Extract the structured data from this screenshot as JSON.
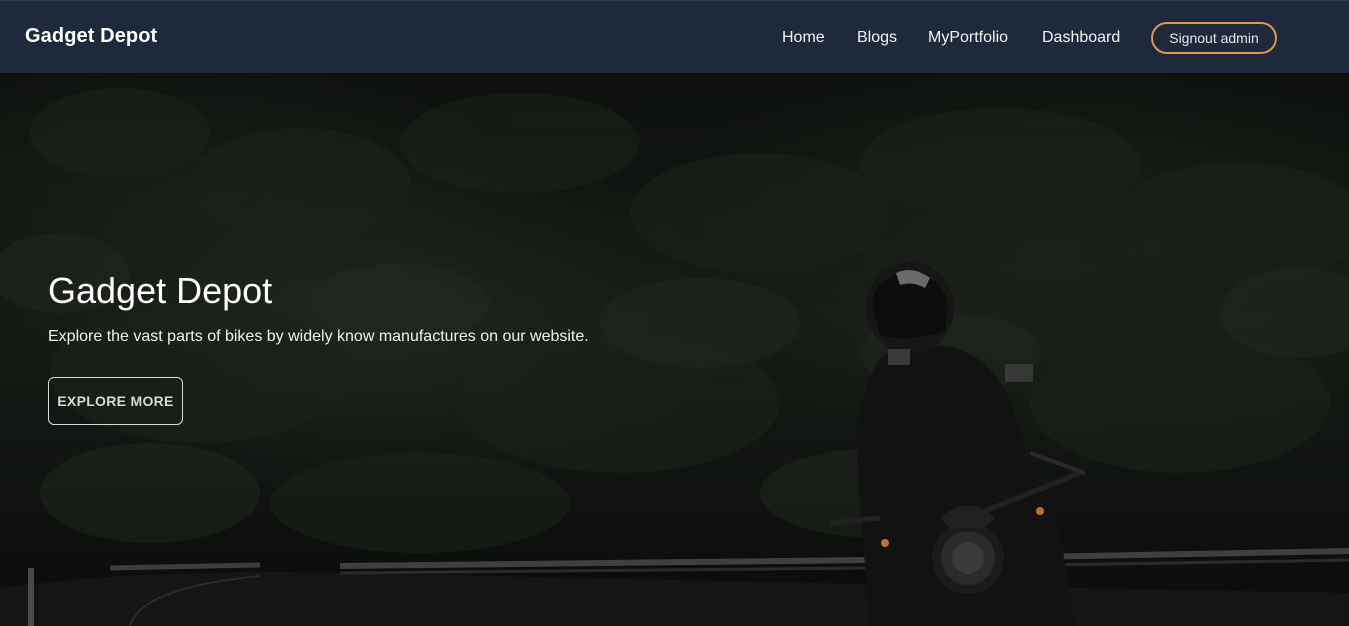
{
  "navbar": {
    "brand": "Gadget Depot",
    "links": [
      "Home",
      "Blogs",
      "MyPortfolio",
      "Dashboard"
    ],
    "signout_label": "Signout admin",
    "background_color": "#1e293b",
    "signout_border_color": "#e7944b"
  },
  "hero": {
    "title": "Gadget Depot",
    "subtitle": "Explore the vast parts of bikes by widely know manufactures on our website.",
    "button_label": "EXPLORE MORE",
    "background": "motorcycle-rider-on-mountain-road-photo"
  }
}
